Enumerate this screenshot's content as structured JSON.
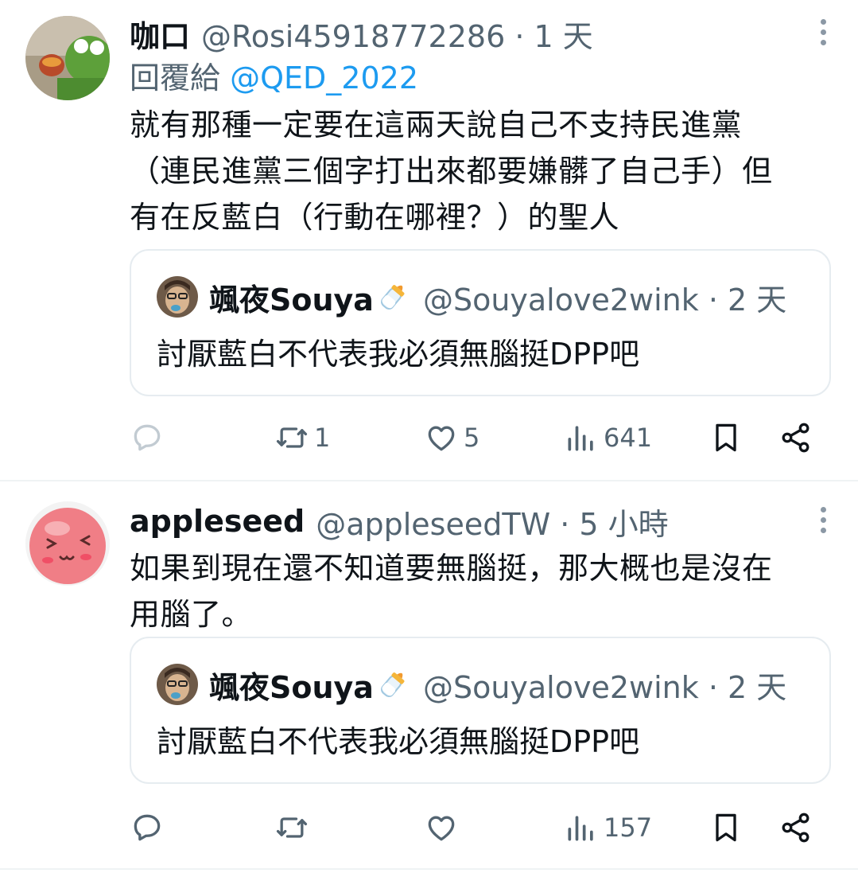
{
  "tweets": [
    {
      "author_name": "咖口",
      "author_handle": "@Rosi45918772286 · 1 天",
      "reply_prefix": "回覆給",
      "reply_to": "@QED_2022",
      "text_lines": [
        "就有那種一定要在這兩天說自己不支持民進黨",
        "（連民進黨三個字打出來都要嫌髒了自己手）但",
        "有在反藍白（行動在哪裡？）的聖人"
      ],
      "quote": {
        "name": "颯夜Souya",
        "handle": "@Souyalove2wink · 2 天",
        "text": "討厭藍白不代表我必須無腦挺DPP吧"
      },
      "stats": {
        "replies": "",
        "retweets": "1",
        "likes": "5",
        "views": "641"
      }
    },
    {
      "author_name": "appleseed",
      "author_handle": "@appleseedTW · 5 小時",
      "text_lines": [
        "如果到現在還不知道要無腦挺，那大概也是沒在",
        "用腦了。"
      ],
      "quote": {
        "name": "颯夜Souya",
        "handle": "@Souyalove2wink · 2 天",
        "text": "討厭藍白不代表我必須無腦挺DPP吧"
      },
      "stats": {
        "replies": "",
        "retweets": "",
        "likes": "",
        "views": "157"
      }
    }
  ],
  "icons": [
    "reply-icon",
    "retweet-icon",
    "like-icon",
    "views-icon",
    "bookmark-icon",
    "share-icon",
    "more-icon"
  ],
  "colors": {
    "text": "#0f1419",
    "secondary": "#536471",
    "link": "#1d9bf0",
    "divider": "#eff3f4"
  }
}
